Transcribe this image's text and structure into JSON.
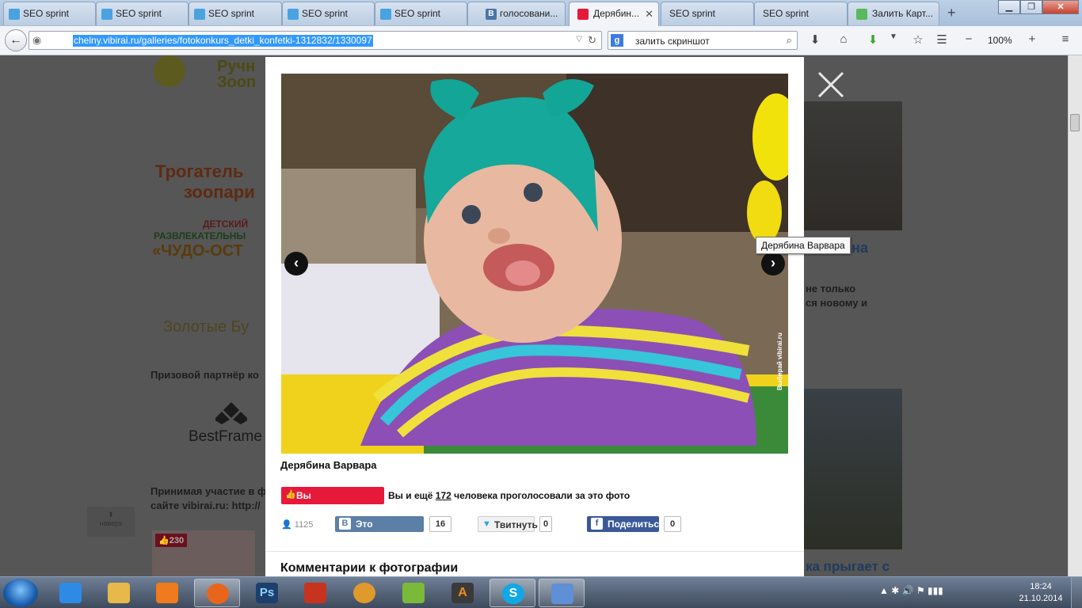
{
  "tabs": [
    {
      "label": "SEO sprint",
      "favicon_color": "#4aa3df",
      "active": false
    },
    {
      "label": "SEO sprint",
      "favicon_color": "#4aa3df",
      "active": false
    },
    {
      "label": "SEO sprint",
      "favicon_color": "#4aa3df",
      "active": false
    },
    {
      "label": "SEO sprint",
      "favicon_color": "#4aa3df",
      "active": false
    },
    {
      "label": "SEO sprint",
      "favicon_color": "#4aa3df",
      "active": false
    },
    {
      "label": "голосовани...",
      "favicon_color": "#4c75a3",
      "active": false
    },
    {
      "label": "Дерябин...",
      "favicon_color": "#e6193a",
      "active": true
    },
    {
      "label": "SEO sprint",
      "favicon_color": "#4aa3df",
      "active": false
    },
    {
      "label": "SEO sprint",
      "favicon_color": "#4aa3df",
      "active": false
    },
    {
      "label": "Залить Карт...",
      "favicon_color": "#5cb85c",
      "active": false
    }
  ],
  "new_tab": "+",
  "window_controls": {
    "minimize": "▁",
    "maximize": "❐",
    "close": "✕"
  },
  "navbar": {
    "url": "chelny.vibirai.ru/galleries/fotokonkurs_detki_konfetki-1312832/1330097",
    "search_engine": "g",
    "search_query": "залить скриншот",
    "zoom": "100%"
  },
  "background_page": {
    "texts": {
      "partner_label": "Призовой партнёр ко",
      "bestframe": "BestFrame",
      "participation_line1": "Принимая участие в ф",
      "participation_line2": "сайте vibirai.ru: http://",
      "right_heading": "на",
      "right_text1": "не только",
      "right_text2": "ся новому и",
      "right_bottom": "ка прыгает с",
      "likes_badge": "230",
      "sponsor1_line1": "Трогатель",
      "sponsor1_line2": "зоопари",
      "sponsor2_line1": "ДЕТСКИЙ",
      "sponsor2_line2": "РАЗВЛЕКАТЕЛЬНЫ",
      "sponsor2_line3": "«ЧУДО-ОСТ",
      "sponsor3": "Золотые Бу",
      "back_to_top": "наверх"
    }
  },
  "modal": {
    "caption": "Дерябина Варвара",
    "tooltip": "Дерябина Варвара",
    "watermark": "Выбирай vibirai.ru",
    "vote_button": "Вы проголосовали",
    "vote_text_before": "Вы и ещё",
    "vote_count": "172",
    "vote_text_after": "человека проголосовали за это фото",
    "views": "1125",
    "share": {
      "vk_label": "Это интересно",
      "vk_count": "16",
      "twitter_label": "Твитнуть",
      "twitter_count": "0",
      "fb_label": "Поделиться",
      "fb_count": "0"
    },
    "comments_heading": "Комментарии к фотографии",
    "prev_arrow": "‹",
    "next_arrow": "›"
  },
  "taskbar": {
    "apps": [
      {
        "name": "internet-explorer",
        "color": "#2f8ae6",
        "open": false
      },
      {
        "name": "windows-explorer",
        "color": "#e6b94a",
        "open": false
      },
      {
        "name": "media-player",
        "color": "#f07a1e",
        "open": false
      },
      {
        "name": "firefox",
        "color": "#e8661b",
        "open": true
      },
      {
        "name": "photoshop",
        "color": "#1c3f6e",
        "open": false
      },
      {
        "name": "filezilla",
        "color": "#c7331f",
        "open": false
      },
      {
        "name": "vlc-like",
        "color": "#e09a2b",
        "open": false
      },
      {
        "name": "utorrent",
        "color": "#7ab93a",
        "open": false
      },
      {
        "name": "aimp",
        "color": "#3a3a3a",
        "open": false
      },
      {
        "name": "skype",
        "color": "#11a8e6",
        "open": true
      },
      {
        "name": "paint",
        "color": "#5f8fd6",
        "open": true
      }
    ],
    "tray": "▲  ✱  🔊  ⚑  ▮▮▮",
    "time": "18:24",
    "date": "21.10.2014"
  }
}
